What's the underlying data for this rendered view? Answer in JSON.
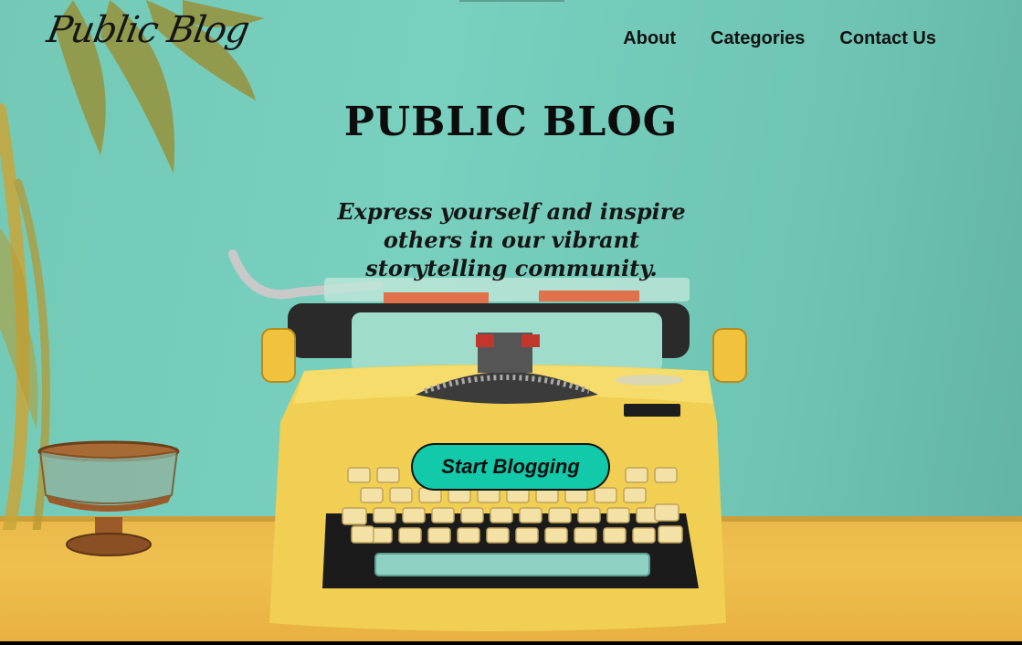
{
  "header": {
    "logo_text": "Public Blog",
    "nav": [
      {
        "label": "About"
      },
      {
        "label": "Categories"
      },
      {
        "label": "Contact Us"
      }
    ]
  },
  "hero": {
    "title": "PUBLIC BLOG",
    "tagline": "Express yourself and inspire others in our vibrant storytelling community.",
    "cta_label": "Start Blogging"
  },
  "colors": {
    "background": "#79d0bf",
    "desk": "#efc04f",
    "typewriter": "#f0cf52",
    "cta": "#12c9a9",
    "text": "#111111"
  },
  "icons": [
    "palm-leaves",
    "glass-bowl",
    "yellow-typewriter"
  ]
}
